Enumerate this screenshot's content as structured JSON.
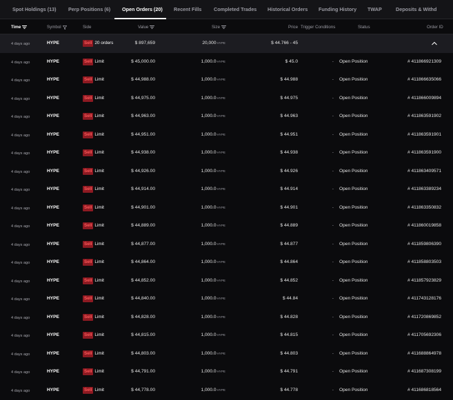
{
  "tabs": [
    {
      "label": "Spot Holdings (13)",
      "active": false
    },
    {
      "label": "Perp Positions (6)",
      "active": false
    },
    {
      "label": "Open Orders (20)",
      "active": true
    },
    {
      "label": "Recent Fills",
      "active": false
    },
    {
      "label": "Completed Trades",
      "active": false
    },
    {
      "label": "Historical Orders",
      "active": false
    },
    {
      "label": "Funding History",
      "active": false
    },
    {
      "label": "TWAP",
      "active": false
    },
    {
      "label": "Deposits & Withd",
      "active": false
    }
  ],
  "columns": {
    "time": "Time",
    "symbol": "Symbol",
    "side": "Side",
    "value": "Value",
    "size": "Size",
    "price": "Price",
    "trigger": "Trigger Conditions",
    "status": "Status",
    "order_id": "Order ID"
  },
  "colors": {
    "sell_text": "#ff5a5a",
    "sell_bg": "#8e1a22",
    "summary_bg": "#1c1c21"
  },
  "summary": {
    "time": "4 days ago",
    "symbol": "HYPE",
    "side": "Sell",
    "type": "20 orders",
    "value": "$ 897,659",
    "size": "20,000",
    "size_unit": "HYPE",
    "price": "$ 44.766 - 45"
  },
  "orders": [
    {
      "time": "4 days ago",
      "symbol": "HYPE",
      "side": "Sell",
      "type": "Limit",
      "value": "$ 45,000.00",
      "size": "1,000.0",
      "size_unit": "HYPE",
      "price": "$ 45.0",
      "trigger": "-",
      "status": "Open Position",
      "order_id": "# 411866921309"
    },
    {
      "time": "4 days ago",
      "symbol": "HYPE",
      "side": "Sell",
      "type": "Limit",
      "value": "$ 44,988.00",
      "size": "1,000.0",
      "size_unit": "HYPE",
      "price": "$ 44.988",
      "trigger": "-",
      "status": "Open Position",
      "order_id": "# 411866635066"
    },
    {
      "time": "4 days ago",
      "symbol": "HYPE",
      "side": "Sell",
      "type": "Limit",
      "value": "$ 44,975.00",
      "size": "1,000.0",
      "size_unit": "HYPE",
      "price": "$ 44.975",
      "trigger": "-",
      "status": "Open Position",
      "order_id": "# 411866009894"
    },
    {
      "time": "4 days ago",
      "symbol": "HYPE",
      "side": "Sell",
      "type": "Limit",
      "value": "$ 44,963.00",
      "size": "1,000.0",
      "size_unit": "HYPE",
      "price": "$ 44.963",
      "trigger": "-",
      "status": "Open Position",
      "order_id": "# 411863591902"
    },
    {
      "time": "4 days ago",
      "symbol": "HYPE",
      "side": "Sell",
      "type": "Limit",
      "value": "$ 44,951.00",
      "size": "1,000.0",
      "size_unit": "HYPE",
      "price": "$ 44.951",
      "trigger": "-",
      "status": "Open Position",
      "order_id": "# 411863591901"
    },
    {
      "time": "4 days ago",
      "symbol": "HYPE",
      "side": "Sell",
      "type": "Limit",
      "value": "$ 44,938.00",
      "size": "1,000.0",
      "size_unit": "HYPE",
      "price": "$ 44.938",
      "trigger": "-",
      "status": "Open Position",
      "order_id": "# 411863591900"
    },
    {
      "time": "4 days ago",
      "symbol": "HYPE",
      "side": "Sell",
      "type": "Limit",
      "value": "$ 44,926.00",
      "size": "1,000.0",
      "size_unit": "HYPE",
      "price": "$ 44.926",
      "trigger": "-",
      "status": "Open Position",
      "order_id": "# 411863409571"
    },
    {
      "time": "4 days ago",
      "symbol": "HYPE",
      "side": "Sell",
      "type": "Limit",
      "value": "$ 44,914.00",
      "size": "1,000.0",
      "size_unit": "HYPE",
      "price": "$ 44.914",
      "trigger": "-",
      "status": "Open Position",
      "order_id": "# 411863389234"
    },
    {
      "time": "4 days ago",
      "symbol": "HYPE",
      "side": "Sell",
      "type": "Limit",
      "value": "$ 44,901.00",
      "size": "1,000.0",
      "size_unit": "HYPE",
      "price": "$ 44.901",
      "trigger": "-",
      "status": "Open Position",
      "order_id": "# 411863350832"
    },
    {
      "time": "4 days ago",
      "symbol": "HYPE",
      "side": "Sell",
      "type": "Limit",
      "value": "$ 44,889.00",
      "size": "1,000.0",
      "size_unit": "HYPE",
      "price": "$ 44.889",
      "trigger": "-",
      "status": "Open Position",
      "order_id": "# 411860019858"
    },
    {
      "time": "4 days ago",
      "symbol": "HYPE",
      "side": "Sell",
      "type": "Limit",
      "value": "$ 44,877.00",
      "size": "1,000.0",
      "size_unit": "HYPE",
      "price": "$ 44.877",
      "trigger": "-",
      "status": "Open Position",
      "order_id": "# 411859806390"
    },
    {
      "time": "4 days ago",
      "symbol": "HYPE",
      "side": "Sell",
      "type": "Limit",
      "value": "$ 44,864.00",
      "size": "1,000.0",
      "size_unit": "HYPE",
      "price": "$ 44.864",
      "trigger": "-",
      "status": "Open Position",
      "order_id": "# 411858803503"
    },
    {
      "time": "4 days ago",
      "symbol": "HYPE",
      "side": "Sell",
      "type": "Limit",
      "value": "$ 44,852.00",
      "size": "1,000.0",
      "size_unit": "HYPE",
      "price": "$ 44.852",
      "trigger": "-",
      "status": "Open Position",
      "order_id": "# 411857923829"
    },
    {
      "time": "4 days ago",
      "symbol": "HYPE",
      "side": "Sell",
      "type": "Limit",
      "value": "$ 44,840.00",
      "size": "1,000.0",
      "size_unit": "HYPE",
      "price": "$ 44.84",
      "trigger": "-",
      "status": "Open Position",
      "order_id": "# 411743128176"
    },
    {
      "time": "4 days ago",
      "symbol": "HYPE",
      "side": "Sell",
      "type": "Limit",
      "value": "$ 44,828.00",
      "size": "1,000.0",
      "size_unit": "HYPE",
      "price": "$ 44.828",
      "trigger": "-",
      "status": "Open Position",
      "order_id": "# 411720869852"
    },
    {
      "time": "4 days ago",
      "symbol": "HYPE",
      "side": "Sell",
      "type": "Limit",
      "value": "$ 44,815.00",
      "size": "1,000.0",
      "size_unit": "HYPE",
      "price": "$ 44.815",
      "trigger": "-",
      "status": "Open Position",
      "order_id": "# 411705692306"
    },
    {
      "time": "4 days ago",
      "symbol": "HYPE",
      "side": "Sell",
      "type": "Limit",
      "value": "$ 44,803.00",
      "size": "1,000.0",
      "size_unit": "HYPE",
      "price": "$ 44.803",
      "trigger": "-",
      "status": "Open Position",
      "order_id": "# 411688864978"
    },
    {
      "time": "4 days ago",
      "symbol": "HYPE",
      "side": "Sell",
      "type": "Limit",
      "value": "$ 44,791.00",
      "size": "1,000.0",
      "size_unit": "HYPE",
      "price": "$ 44.791",
      "trigger": "-",
      "status": "Open Position",
      "order_id": "# 411687308199"
    },
    {
      "time": "4 days ago",
      "symbol": "HYPE",
      "side": "Sell",
      "type": "Limit",
      "value": "$ 44,778.00",
      "size": "1,000.0",
      "size_unit": "HYPE",
      "price": "$ 44.778",
      "trigger": "-",
      "status": "Open Position",
      "order_id": "# 411686818564"
    }
  ]
}
